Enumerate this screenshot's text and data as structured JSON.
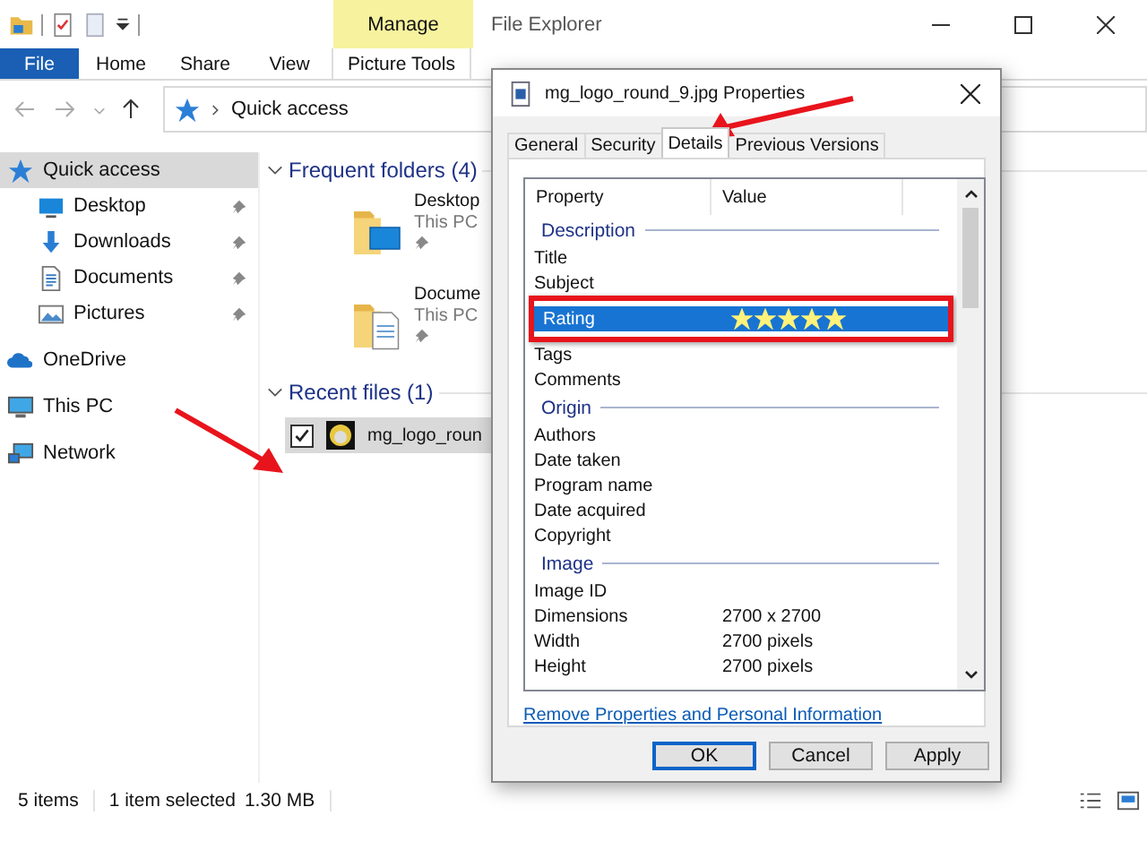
{
  "window": {
    "title": "File Explorer"
  },
  "ribbon": {
    "context_label": "Manage",
    "tabs": [
      {
        "label": "File",
        "kind": "file"
      },
      {
        "label": "Home",
        "kind": "tab"
      },
      {
        "label": "Share",
        "kind": "tab"
      },
      {
        "label": "View",
        "kind": "tab"
      },
      {
        "label": "Picture Tools",
        "kind": "context"
      }
    ]
  },
  "address": {
    "path": "Quick access"
  },
  "nav": [
    {
      "label": "Quick access",
      "kind": "star",
      "selected": true,
      "children": [
        {
          "label": "Desktop",
          "kind": "desktop",
          "selected": false,
          "pinned": true
        },
        {
          "label": "Downloads",
          "kind": "download",
          "selected": false,
          "pinned": true
        },
        {
          "label": "Documents",
          "kind": "document",
          "selected": false,
          "pinned": true
        },
        {
          "label": "Pictures",
          "kind": "picture",
          "selected": false,
          "pinned": true
        }
      ]
    },
    {
      "label": "OneDrive",
      "kind": "cloud",
      "selected": false
    },
    {
      "label": "This PC",
      "kind": "pc",
      "selected": false
    },
    {
      "label": "Network",
      "kind": "network",
      "selected": false
    }
  ],
  "frequent": {
    "heading": "Frequent folders (4)",
    "items": [
      {
        "name": "Desktop",
        "location": "This PC",
        "kind": "desktop",
        "pinned": true
      },
      {
        "name": "Docume",
        "location": "This PC",
        "kind": "document",
        "pinned": true
      }
    ]
  },
  "recent": {
    "heading": "Recent files (1)",
    "items": [
      {
        "name": "mg_logo_roun",
        "selected": true,
        "checked": true
      }
    ]
  },
  "status_bar": {
    "count": "5 items",
    "selection": "1 item selected",
    "size": "1.30 MB"
  },
  "dialog": {
    "title": "mg_logo_round_9.jpg Properties",
    "tabs": [
      {
        "label": "General",
        "selected": false
      },
      {
        "label": "Security",
        "selected": false
      },
      {
        "label": "Details",
        "selected": true
      },
      {
        "label": "Previous Versions",
        "selected": false
      }
    ],
    "columns": [
      "Property",
      "Value"
    ],
    "rows": [
      {
        "kind": "group",
        "label": "Description"
      },
      {
        "kind": "prop",
        "name": "Title",
        "selected": false
      },
      {
        "kind": "prop",
        "name": "Subject",
        "selected": false
      },
      {
        "kind": "rating",
        "name": "Rating",
        "stars": 5,
        "selected": true
      },
      {
        "kind": "prop",
        "name": "Tags",
        "selected": false
      },
      {
        "kind": "prop",
        "name": "Comments",
        "selected": false
      },
      {
        "kind": "group",
        "label": "Origin"
      },
      {
        "kind": "prop",
        "name": "Authors",
        "selected": false
      },
      {
        "kind": "prop",
        "name": "Date taken",
        "selected": false
      },
      {
        "kind": "prop",
        "name": "Program name",
        "selected": false
      },
      {
        "kind": "prop",
        "name": "Date acquired",
        "selected": false
      },
      {
        "kind": "prop",
        "name": "Copyright",
        "selected": false
      },
      {
        "kind": "group",
        "label": "Image"
      },
      {
        "kind": "prop",
        "name": "Image ID",
        "selected": false
      },
      {
        "kind": "prop",
        "name": "Dimensions",
        "value": "2700 x 2700",
        "selected": false
      },
      {
        "kind": "prop",
        "name": "Width",
        "value": "2700 pixels",
        "selected": false
      },
      {
        "kind": "prop",
        "name": "Height",
        "value": "2700 pixels",
        "selected": false
      }
    ],
    "link": "Remove Properties and Personal Information",
    "buttons": [
      {
        "label": "OK",
        "default": true
      },
      {
        "label": "Cancel",
        "default": false
      },
      {
        "label": "Apply",
        "default": false
      }
    ]
  }
}
